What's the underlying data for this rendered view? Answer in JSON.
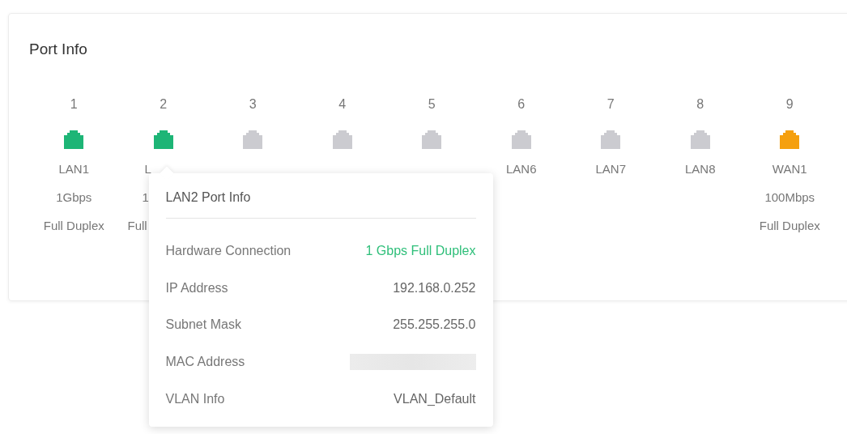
{
  "card": {
    "title": "Port Info"
  },
  "ports": [
    {
      "number": "1",
      "color": "#1db576",
      "name": "LAN1",
      "speed": "1Gbps",
      "duplex": "Full Duplex"
    },
    {
      "number": "2",
      "color": "#1db576",
      "name": "L",
      "speed": "1",
      "duplex": "Full",
      "selected": true
    },
    {
      "number": "3",
      "color": "#cbcbd0"
    },
    {
      "number": "4",
      "color": "#cbcbd0"
    },
    {
      "number": "5",
      "color": "#cbcbd0"
    },
    {
      "number": "6",
      "color": "#cbcbd0",
      "name": "LAN6"
    },
    {
      "number": "7",
      "color": "#cbcbd0",
      "name": "LAN7"
    },
    {
      "number": "8",
      "color": "#cbcbd0",
      "name": "LAN8"
    },
    {
      "number": "9",
      "color": "#f5a00f",
      "name": "WAN1",
      "speed": "100Mbps",
      "duplex": "Full Duplex"
    }
  ],
  "popover": {
    "title": "LAN2 Port Info",
    "rows": [
      {
        "label": "Hardware Connection",
        "value": "1 Gbps Full Duplex",
        "kind": "highlight"
      },
      {
        "label": "IP Address",
        "value": "192.168.0.252",
        "kind": "text"
      },
      {
        "label": "Subnet Mask",
        "value": "255.255.255.0",
        "kind": "text"
      },
      {
        "label": "MAC Address",
        "kind": "redacted"
      },
      {
        "label": "VLAN Info",
        "value": "VLAN_Default",
        "kind": "text"
      }
    ]
  }
}
